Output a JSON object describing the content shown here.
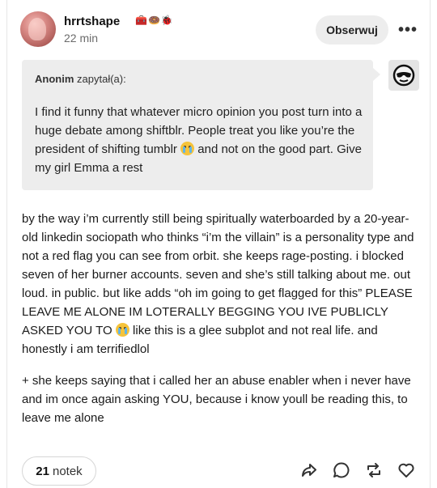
{
  "post": {
    "username": "hrrtshape",
    "badges": "🧰🍩🐞",
    "timestamp": "22 min",
    "follow_label": "Obserwuj",
    "more_label": "•••"
  },
  "ask": {
    "asker": "Anonim",
    "asked_suffix": "zapytał(a):",
    "text_part1": "I find it funny that whatever micro opinion you post turn into a huge debate among shiftblr. People treat you like you’re the president of shifting tumblr ",
    "text_part2": " and not on the good part. Give my girl Emma a rest"
  },
  "body": {
    "p1_part1": "by the way i’m currently still being spiritually waterboarded by a 20-year-old linkedin sociopath who thinks “i’m the villain” is a personality type and not a red flag you can see from orbit. she keeps rage-posting. i blocked seven of her burner accounts. seven and she’s still talking about me. out loud. in public. but like adds “oh im going to get flagged for this” PLEASE LEAVE ME ALONE IM LOTERALLY BEGGING YOU IVE PUBLICLY ASKED YOU TO ",
    "p1_part2": " like this is a glee subplot and not real life. and honestly i am terrifiedlol",
    "p2": "+ she keeps saying that i called her an abuse enabler when i never have and im once again asking YOU, because i know youll be reading this, to leave me alone"
  },
  "footer": {
    "notes_count": "21",
    "notes_label": "notek"
  }
}
